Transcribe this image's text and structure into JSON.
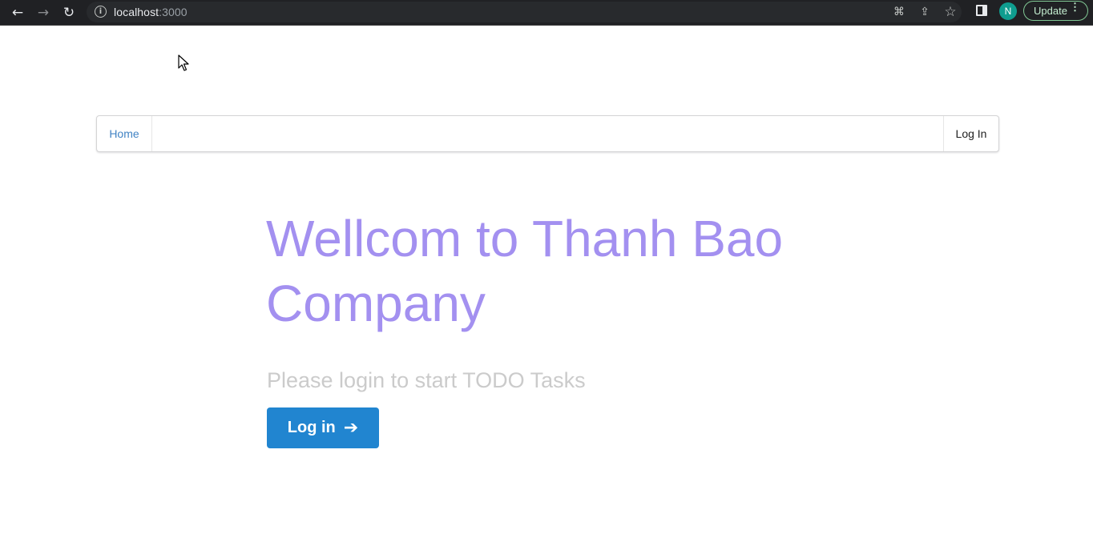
{
  "browser": {
    "url_host": "localhost",
    "url_port": ":3000",
    "avatar_initial": "N",
    "update_label": "Update"
  },
  "icons": {
    "back": "←",
    "forward": "→",
    "reload": "↻",
    "info": "i",
    "translate": "⌘",
    "share": "⇪",
    "star": "☆",
    "menu": "⋮"
  },
  "navbar": {
    "home_label": "Home",
    "login_label": "Log In"
  },
  "hero": {
    "title": "Wellcom to Thanh Bao Company",
    "subtitle": "Please login to start TODO Tasks",
    "button_label": "Log in",
    "button_arrow": "➔"
  },
  "colors": {
    "title": "#a390f0",
    "button": "#2185d0",
    "link": "#4183c4"
  }
}
